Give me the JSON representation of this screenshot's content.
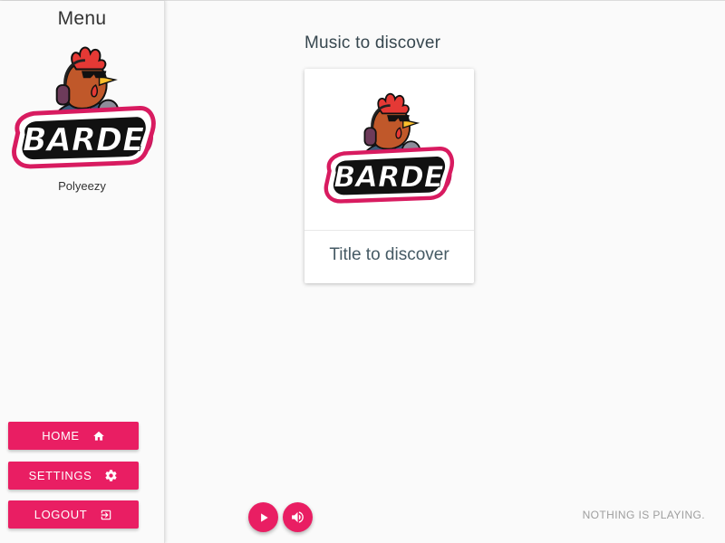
{
  "sidebar": {
    "title": "Menu",
    "username": "Polyeezy",
    "logo_text": "BARDE",
    "buttons": {
      "home": {
        "label": "HOME",
        "icon": "home-icon"
      },
      "settings": {
        "label": "SETTINGS",
        "icon": "gear-icon"
      },
      "logout": {
        "label": "LOGOUT",
        "icon": "logout-icon"
      }
    }
  },
  "main": {
    "section_title": "Music to discover",
    "card": {
      "title": "Title to discover",
      "logo_text": "BARDE"
    }
  },
  "player": {
    "play_icon": "play-icon",
    "volume_icon": "volume-icon",
    "status": "NOTHING IS PLAYING."
  },
  "colors": {
    "accent": "#e91e63",
    "background": "#fafafa",
    "logo_outline": "#d81b60"
  }
}
